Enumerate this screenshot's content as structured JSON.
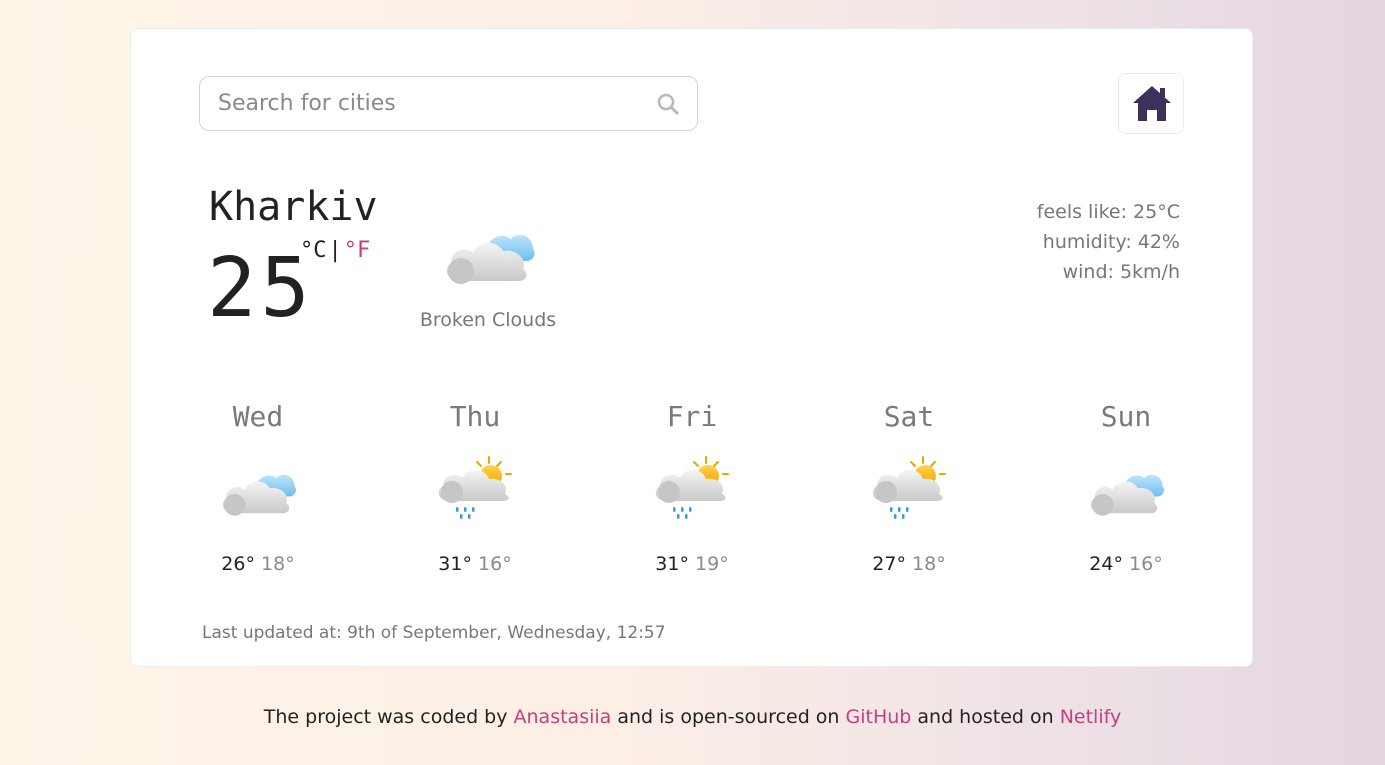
{
  "search": {
    "placeholder": "Search for cities",
    "value": "",
    "icon": "search-icon"
  },
  "home_button": {
    "icon": "home-icon",
    "color": "#3d3159"
  },
  "current": {
    "city": "Kharkiv",
    "temperature": "25",
    "unit_c": "°C",
    "unit_sep": "|",
    "unit_f": "°F",
    "description": "Broken Clouds",
    "icon": "broken-clouds-icon",
    "feels_like": "feels like: 25°C",
    "humidity": "humidity: 42%",
    "wind": "wind: 5km/h"
  },
  "forecast": [
    {
      "day": "Wed",
      "icon": "broken-clouds-icon",
      "max": "26°",
      "min": "18°"
    },
    {
      "day": "Thu",
      "icon": "rain-sun-icon",
      "max": "31°",
      "min": "16°"
    },
    {
      "day": "Fri",
      "icon": "rain-sun-icon",
      "max": "31°",
      "min": "19°"
    },
    {
      "day": "Sat",
      "icon": "rain-sun-icon",
      "max": "27°",
      "min": "18°"
    },
    {
      "day": "Sun",
      "icon": "broken-clouds-icon",
      "max": "24°",
      "min": "16°"
    }
  ],
  "last_updated": "Last updated at: 9th of September, Wednesday, 12:57",
  "footer": {
    "text1": "The project was coded by ",
    "author": "Anastasiia",
    "text2": " and is open-sourced on ",
    "github": "GitHub",
    "text3": " and hosted on ",
    "netlify": "Netlify"
  },
  "colors": {
    "accent": "#c73f7d",
    "home_icon": "#3d3159",
    "muted_text": "#777777"
  }
}
